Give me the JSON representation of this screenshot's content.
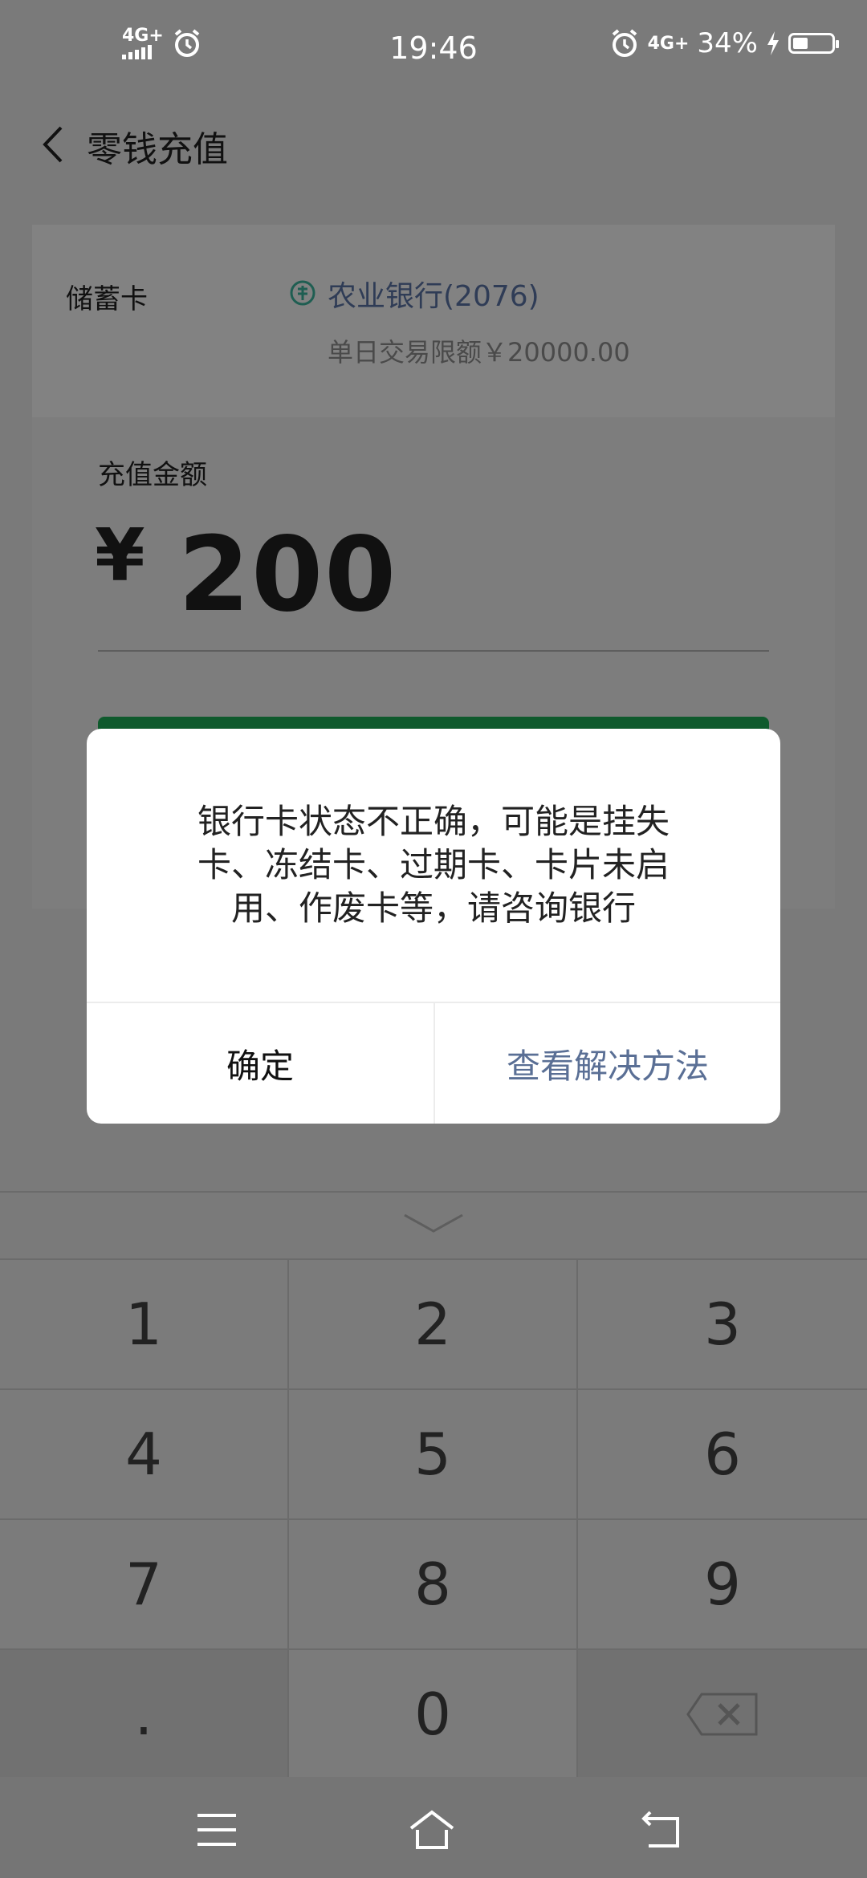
{
  "status_bar": {
    "network_left": "4G+",
    "time": "19:46",
    "network_right": "4G+",
    "battery": "34%"
  },
  "header": {
    "title": "零钱充值"
  },
  "card": {
    "label": "储蓄卡",
    "bank_name": "农业银行(2076)",
    "limit": "单日交易限额￥20000.00"
  },
  "amount": {
    "label": "充值金额",
    "currency": "¥",
    "value": "200"
  },
  "dialog": {
    "message": "银行卡状态不正确，可能是挂失卡、冻结卡、过期卡、卡片未启用、作废卡等，请咨询银行",
    "confirm": "确定",
    "solution": "查看解决方法"
  },
  "keypad": {
    "keys": [
      "1",
      "2",
      "3",
      "4",
      "5",
      "6",
      "7",
      "8",
      "9",
      ".",
      "0"
    ]
  }
}
